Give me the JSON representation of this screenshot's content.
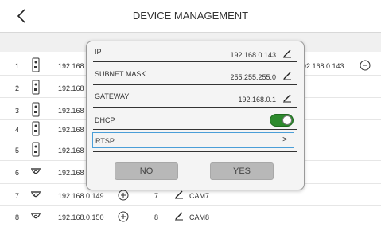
{
  "header": {
    "title": "DEVICE MANAGEMENT"
  },
  "device_rows": [
    {
      "num": "1",
      "type": "doorbell",
      "ip": "192.168"
    },
    {
      "num": "2",
      "type": "doorbell",
      "ip": "192.168"
    },
    {
      "num": "3",
      "type": "doorbell",
      "ip": "192.168"
    },
    {
      "num": "4",
      "type": "doorbell",
      "ip": "192.168"
    },
    {
      "num": "5",
      "type": "doorbell",
      "ip": "192.168"
    },
    {
      "num": "6",
      "type": "camera",
      "ip": "192.168"
    },
    {
      "num": "7",
      "type": "camera",
      "ip": "192.168.0.149"
    },
    {
      "num": "8",
      "type": "camera",
      "ip": "192.168.0.150"
    }
  ],
  "channel_rows": [
    {
      "num": "7",
      "name": "CAM7"
    },
    {
      "num": "8",
      "name": "CAM8"
    }
  ],
  "right_ip": "92.168.0.143",
  "dialog": {
    "ip_label": "IP",
    "ip_value": "192.168.0.143",
    "mask_label": "SUBNET MASK",
    "mask_value": "255.255.255.0",
    "gateway_label": "GATEWAY",
    "gateway_value": "192.168.0.1",
    "dhcp_label": "DHCP",
    "dhcp_enabled": true,
    "rtsp_label": "RTSP",
    "rtsp_chevron": ">",
    "no_label": "NO",
    "yes_label": "YES"
  },
  "colors": {
    "toggle_on": "#2d8a2d",
    "focus_border": "#4a9ed8",
    "button_bg": "#b8b8b8"
  }
}
